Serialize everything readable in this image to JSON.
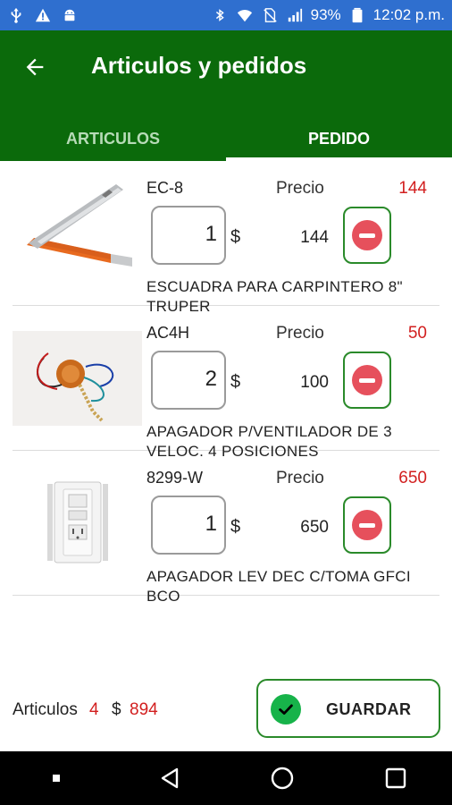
{
  "status_bar": {
    "battery": "93%",
    "time": "12:02 p.m."
  },
  "app_bar": {
    "title": "Articulos y pedidos"
  },
  "tabs": [
    {
      "label": "ARTICULOS",
      "active": false
    },
    {
      "label": "PEDIDO",
      "active": true
    }
  ],
  "items": [
    {
      "code": "EC-8",
      "price_label": "Precio",
      "price": "144",
      "quantity": "1",
      "currency": "$",
      "subtotal": "144",
      "description": "ESCUADRA PARA CARPINTERO 8\" TRUPER",
      "image": "carpenter-square"
    },
    {
      "code": "AC4H",
      "price_label": "Precio",
      "price": "50",
      "quantity": "2",
      "currency": "$",
      "subtotal": "100",
      "description": "APAGADOR P/VENTILADOR DE 3 VELOC.  4 POSICIONES",
      "image": "fan-switch"
    },
    {
      "code": "8299-W",
      "price_label": "Precio",
      "price": "650",
      "quantity": "1",
      "currency": "$",
      "subtotal": "650",
      "description": "APAGADOR LEV DEC C/TOMA GFCI BCO",
      "image": "gfci-outlet"
    }
  ],
  "footer": {
    "articles_label": "Articulos",
    "articles_count": "4",
    "currency": "$",
    "total": "894",
    "save_label": "GUARDAR"
  },
  "colors": {
    "status_bar": "#2f6fcf",
    "app_bar": "#0b6a0b",
    "price_red": "#d21f1f",
    "remove_red": "#e6505c",
    "check_green": "#17b34a"
  }
}
